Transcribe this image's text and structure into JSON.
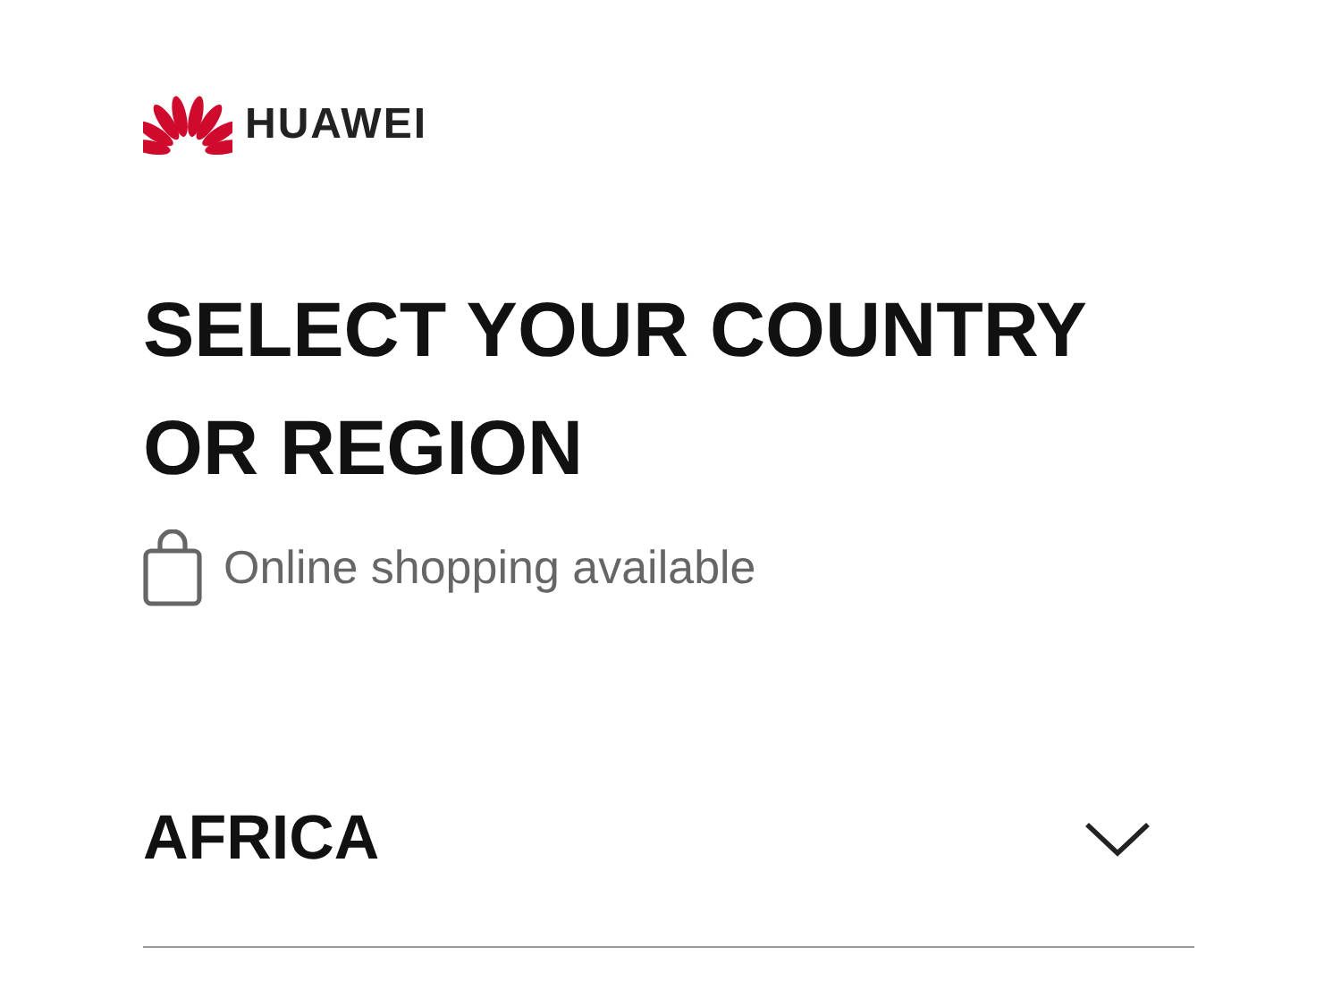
{
  "logo": {
    "text": "HUAWEI"
  },
  "title": "SELECT YOUR COUNTRY OR REGION",
  "legend": {
    "text": "Online shopping available"
  },
  "regions": [
    {
      "name": "AFRICA",
      "expanded": false
    }
  ]
}
